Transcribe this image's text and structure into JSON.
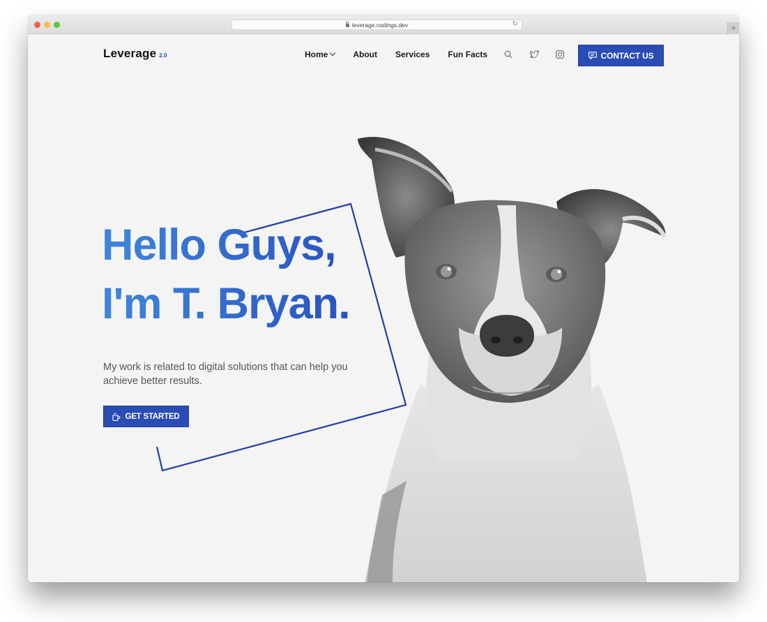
{
  "browser": {
    "url": "leverage.codings.dev",
    "new_tab_label": "+"
  },
  "header": {
    "logo": "Leverage",
    "logo_version": "2.0",
    "nav": [
      {
        "label": "Home",
        "has_dropdown": true
      },
      {
        "label": "About"
      },
      {
        "label": "Services"
      },
      {
        "label": "Fun Facts"
      }
    ],
    "icons": [
      "search-icon",
      "twitter-icon",
      "instagram-icon"
    ],
    "contact_label": "CONTACT US"
  },
  "hero": {
    "title_line1": "Hello Guys,",
    "title_line2": "I'm T. Bryan.",
    "description": "My work is related to digital solutions that can help you achieve better results.",
    "cta_label": "GET STARTED",
    "image_alt": "Black and white portrait of a dog"
  },
  "colors": {
    "accent": "#2a4cb5",
    "title_gradient_start": "#3d87dc",
    "title_gradient_end": "#2a52bd",
    "background": "#f4f4f4",
    "frame_line": "#1e3fa6"
  }
}
